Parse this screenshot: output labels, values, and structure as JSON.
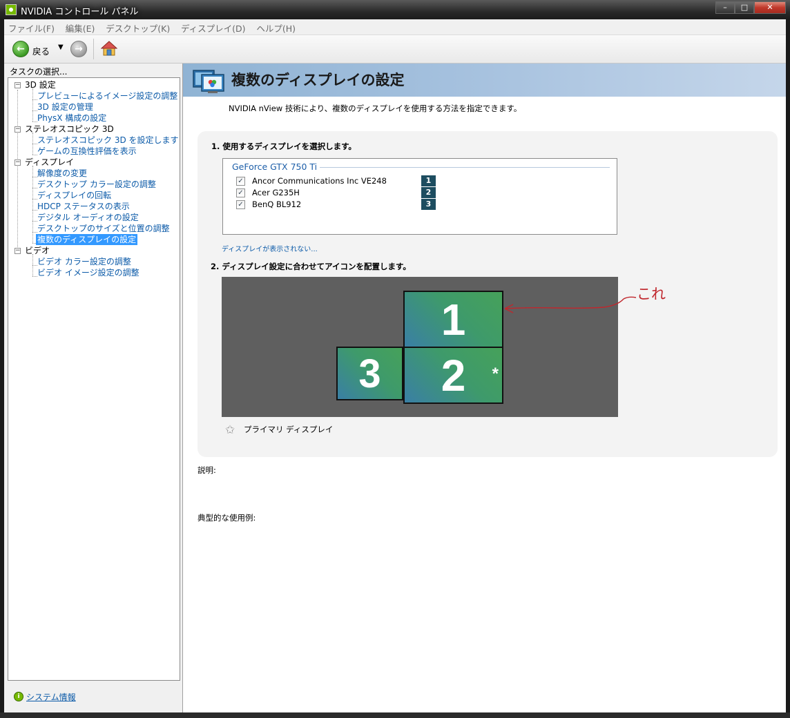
{
  "window": {
    "title": "NVIDIA コントロール パネル",
    "min": "–",
    "max": "□",
    "close": "✕"
  },
  "menu": [
    "ファイル(F)",
    "編集(E)",
    "デスクトップ(K)",
    "ディスプレイ(D)",
    "ヘルプ(H)"
  ],
  "toolbar": {
    "back_label": "戻る",
    "back_icon": "arrow-left-icon",
    "forward_icon": "arrow-right-icon",
    "home_icon": "home-icon"
  },
  "sidebar": {
    "task_label": "タスクの選択...",
    "categories": [
      {
        "label": "3D 設定",
        "items": [
          "プレビューによるイメージ設定の調整",
          "3D 設定の管理",
          "PhysX 構成の設定"
        ]
      },
      {
        "label": "ステレオスコピック 3D",
        "items": [
          "ステレオスコピック 3D を設定します",
          "ゲームの互換性評価を表示"
        ]
      },
      {
        "label": "ディスプレイ",
        "items": [
          "解像度の変更",
          "デスクトップ カラー設定の調整",
          "ディスプレイの回転",
          "HDCP ステータスの表示",
          "デジタル オーディオの設定",
          "デスクトップのサイズと位置の調整",
          "複数のディスプレイの設定"
        ]
      },
      {
        "label": "ビデオ",
        "items": [
          "ビデオ カラー設定の調整",
          "ビデオ イメージ設定の調整"
        ]
      }
    ],
    "selected": "複数のディスプレイの設定",
    "system_info": "システム情報"
  },
  "main": {
    "title": "複数のディスプレイの設定",
    "subtitle": "NVIDIA nView 技術により、複数のディスプレイを使用する方法を指定できます。",
    "section1": "1. 使用するディスプレイを選択します。",
    "gpu": "GeForce GTX 750 Ti",
    "displays": [
      {
        "name": "Ancor Communications Inc VE248",
        "checked": true,
        "num": "1"
      },
      {
        "name": "Acer G235H",
        "checked": true,
        "num": "2"
      },
      {
        "name": "BenQ BL912",
        "checked": true,
        "num": "3"
      }
    ],
    "not_shown_link": "ディスプレイが表示されない...",
    "section2": "2. ディスプレイ設定に合わせてアイコンを配置します。",
    "monitors": [
      {
        "num": "1",
        "primary": false
      },
      {
        "num": "2",
        "primary": true
      },
      {
        "num": "3",
        "primary": false
      }
    ],
    "primary_star": "*",
    "primary_legend": "プライマリ ディスプレイ",
    "description_label": "説明:",
    "usage_label": "典型的な使用例:",
    "annotation": "これ"
  },
  "colors": {
    "accent_link": "#0b5aa8",
    "header_bg": "#a7c2df",
    "selection": "#3399ff",
    "annotation": "#c0272d",
    "monitor_green": "#46a15a",
    "monitor_blue": "#3a7fa5"
  }
}
